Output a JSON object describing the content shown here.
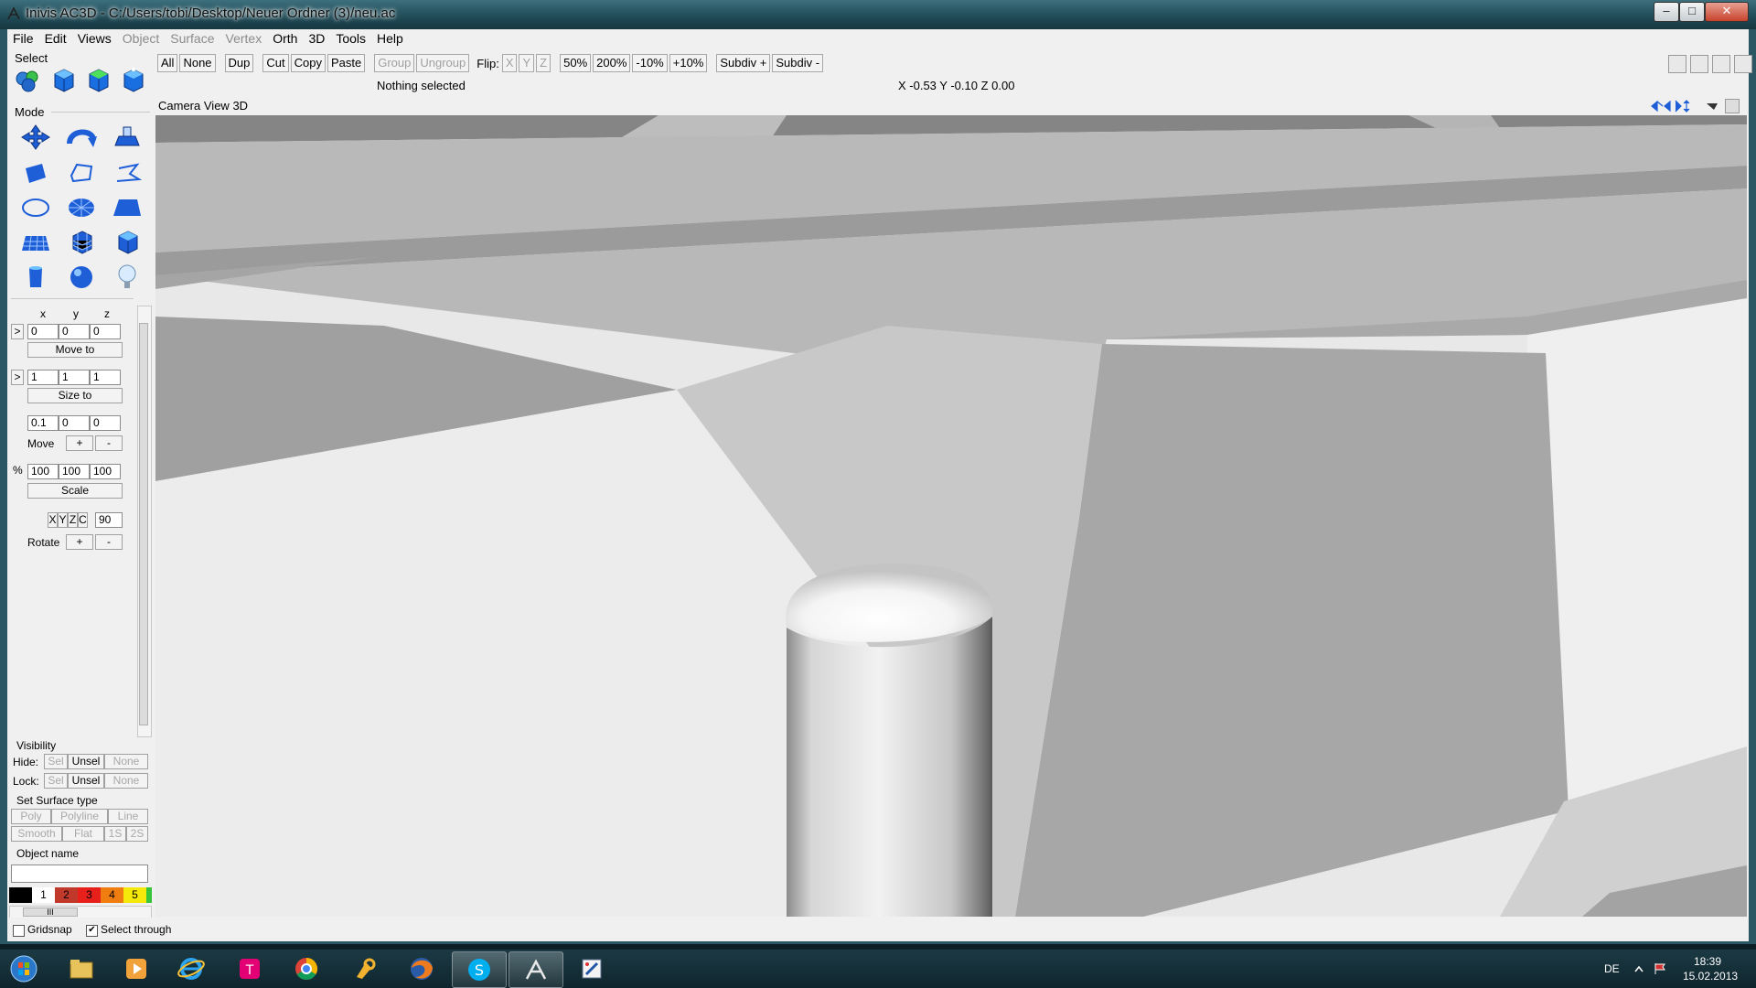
{
  "window": {
    "title": "Inivis AC3D - C:/Users/tobi/Desktop/Neuer Ordner (3)/neu.ac",
    "min_label": "–",
    "max_label": "□",
    "close_label": "✕"
  },
  "menu": [
    {
      "label": "File",
      "enabled": true
    },
    {
      "label": "Edit",
      "enabled": true
    },
    {
      "label": "Views",
      "enabled": true
    },
    {
      "label": "Object",
      "enabled": false
    },
    {
      "label": "Surface",
      "enabled": false
    },
    {
      "label": "Vertex",
      "enabled": false
    },
    {
      "label": "Orth",
      "enabled": true
    },
    {
      "label": "3D",
      "enabled": true
    },
    {
      "label": "Tools",
      "enabled": true
    },
    {
      "label": "Help",
      "enabled": true
    }
  ],
  "toolbar": {
    "all": "All",
    "none": "None",
    "dup": "Dup",
    "cut": "Cut",
    "copy": "Copy",
    "paste": "Paste",
    "group": "Group",
    "ungroup": "Ungroup",
    "flip_label": "Flip:",
    "flip_x": "X",
    "flip_y": "Y",
    "flip_z": "Z",
    "zoom50": "50%",
    "zoom200": "200%",
    "minus10": "-10%",
    "plus10": "+10%",
    "subdiv_plus": "Subdiv +",
    "subdiv_minus": "Subdiv -"
  },
  "status": {
    "selection": "Nothing selected",
    "coords": "X -0.53 Y -0.10 Z 0.00"
  },
  "panel": {
    "select_label": "Select",
    "mode_label": "Mode",
    "axis_x": "x",
    "axis_y": "y",
    "axis_z": "z",
    "arrow": ">",
    "pos": {
      "x": "0",
      "y": "0",
      "z": "0"
    },
    "move_to": "Move to",
    "size": {
      "x": "1",
      "y": "1",
      "z": "1"
    },
    "size_to": "Size to",
    "step": {
      "x": "0.1",
      "y": "0",
      "z": "0"
    },
    "move_label": "Move",
    "plus": "+",
    "minus": "-",
    "pct": "%",
    "scale_vals": {
      "x": "100",
      "y": "100",
      "z": "100"
    },
    "scale": "Scale",
    "rot_x": "X",
    "rot_y": "Y",
    "rot_z": "Z",
    "rot_c": "C",
    "angle": "90",
    "rotate_label": "Rotate",
    "visibility_label": "Visibility",
    "hide_label": "Hide:",
    "lock_label": "Lock:",
    "sel": "Sel",
    "unsel": "Unsel",
    "none": "None",
    "surface_label": "Set Surface type",
    "poly": "Poly",
    "polyline": "Polyline",
    "line": "Line",
    "smooth": "Smooth",
    "flat": "Flat",
    "one_s": "1S",
    "two_s": "2S",
    "object_name_label": "Object name",
    "object_name": "",
    "colors": [
      {
        "label": "",
        "color": "#000000"
      },
      {
        "label": "1",
        "color": "#ffffff"
      },
      {
        "label": "2",
        "color": "#c0392b"
      },
      {
        "label": "3",
        "color": "#e8201b"
      },
      {
        "label": "4",
        "color": "#f07d10"
      },
      {
        "label": "5",
        "color": "#f5e80b"
      },
      {
        "label": "",
        "color": "#38c43a"
      }
    ],
    "hscroll_grip": "III"
  },
  "view": {
    "camera": "Camera",
    "view": "View",
    "mode": "3D"
  },
  "bottom": {
    "gridsnap": "Gridsnap",
    "gridsnap_checked": false,
    "select_through": "Select through",
    "select_through_checked": true
  },
  "tray": {
    "lang": "DE",
    "time": "18:39",
    "date": "15.02.2013"
  }
}
